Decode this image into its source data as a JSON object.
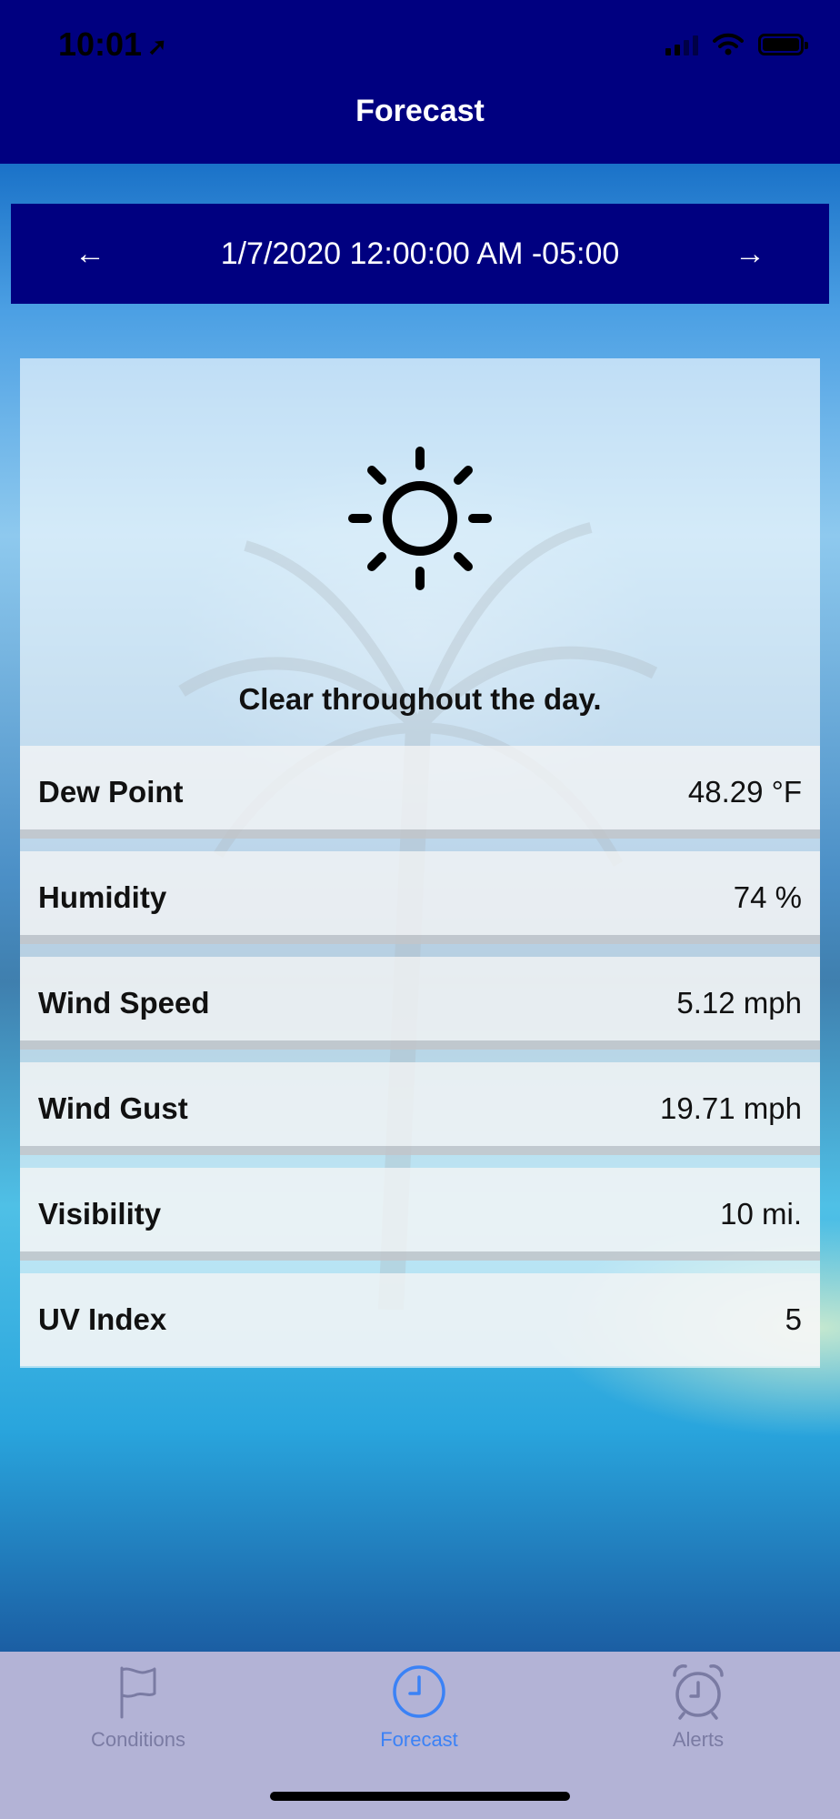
{
  "status_bar": {
    "time": "10:01",
    "location_icon": "location-arrow-icon",
    "signal_icon": "cellular-signal-icon",
    "wifi_icon": "wifi-icon",
    "battery_icon": "battery-icon"
  },
  "nav": {
    "title": "Forecast"
  },
  "date_nav": {
    "date": "1/7/2020 12:00:00 AM -05:00",
    "prev_icon": "arrow-left-icon",
    "next_icon": "arrow-right-icon"
  },
  "forecast": {
    "icon": "sun-icon",
    "summary": "Clear throughout the day.",
    "rows": [
      {
        "label": "Dew Point",
        "value": "48.29 °F"
      },
      {
        "label": "Humidity",
        "value": "74 %"
      },
      {
        "label": "Wind Speed",
        "value": "5.12 mph"
      },
      {
        "label": "Wind Gust",
        "value": "19.71 mph"
      },
      {
        "label": "Visibility",
        "value": "10 mi."
      },
      {
        "label": "UV Index",
        "value": "5"
      }
    ]
  },
  "tabs": [
    {
      "label": "Conditions",
      "icon": "flag-icon",
      "active": false
    },
    {
      "label": "Forecast",
      "icon": "clock-icon",
      "active": true
    },
    {
      "label": "Alerts",
      "icon": "alarm-clock-icon",
      "active": false
    }
  ],
  "colors": {
    "nav_background": "#000080",
    "tab_bar_background": "#b3b3d6",
    "active_tab": "#3b82f6",
    "inactive_tab": "#7a7ba3"
  }
}
